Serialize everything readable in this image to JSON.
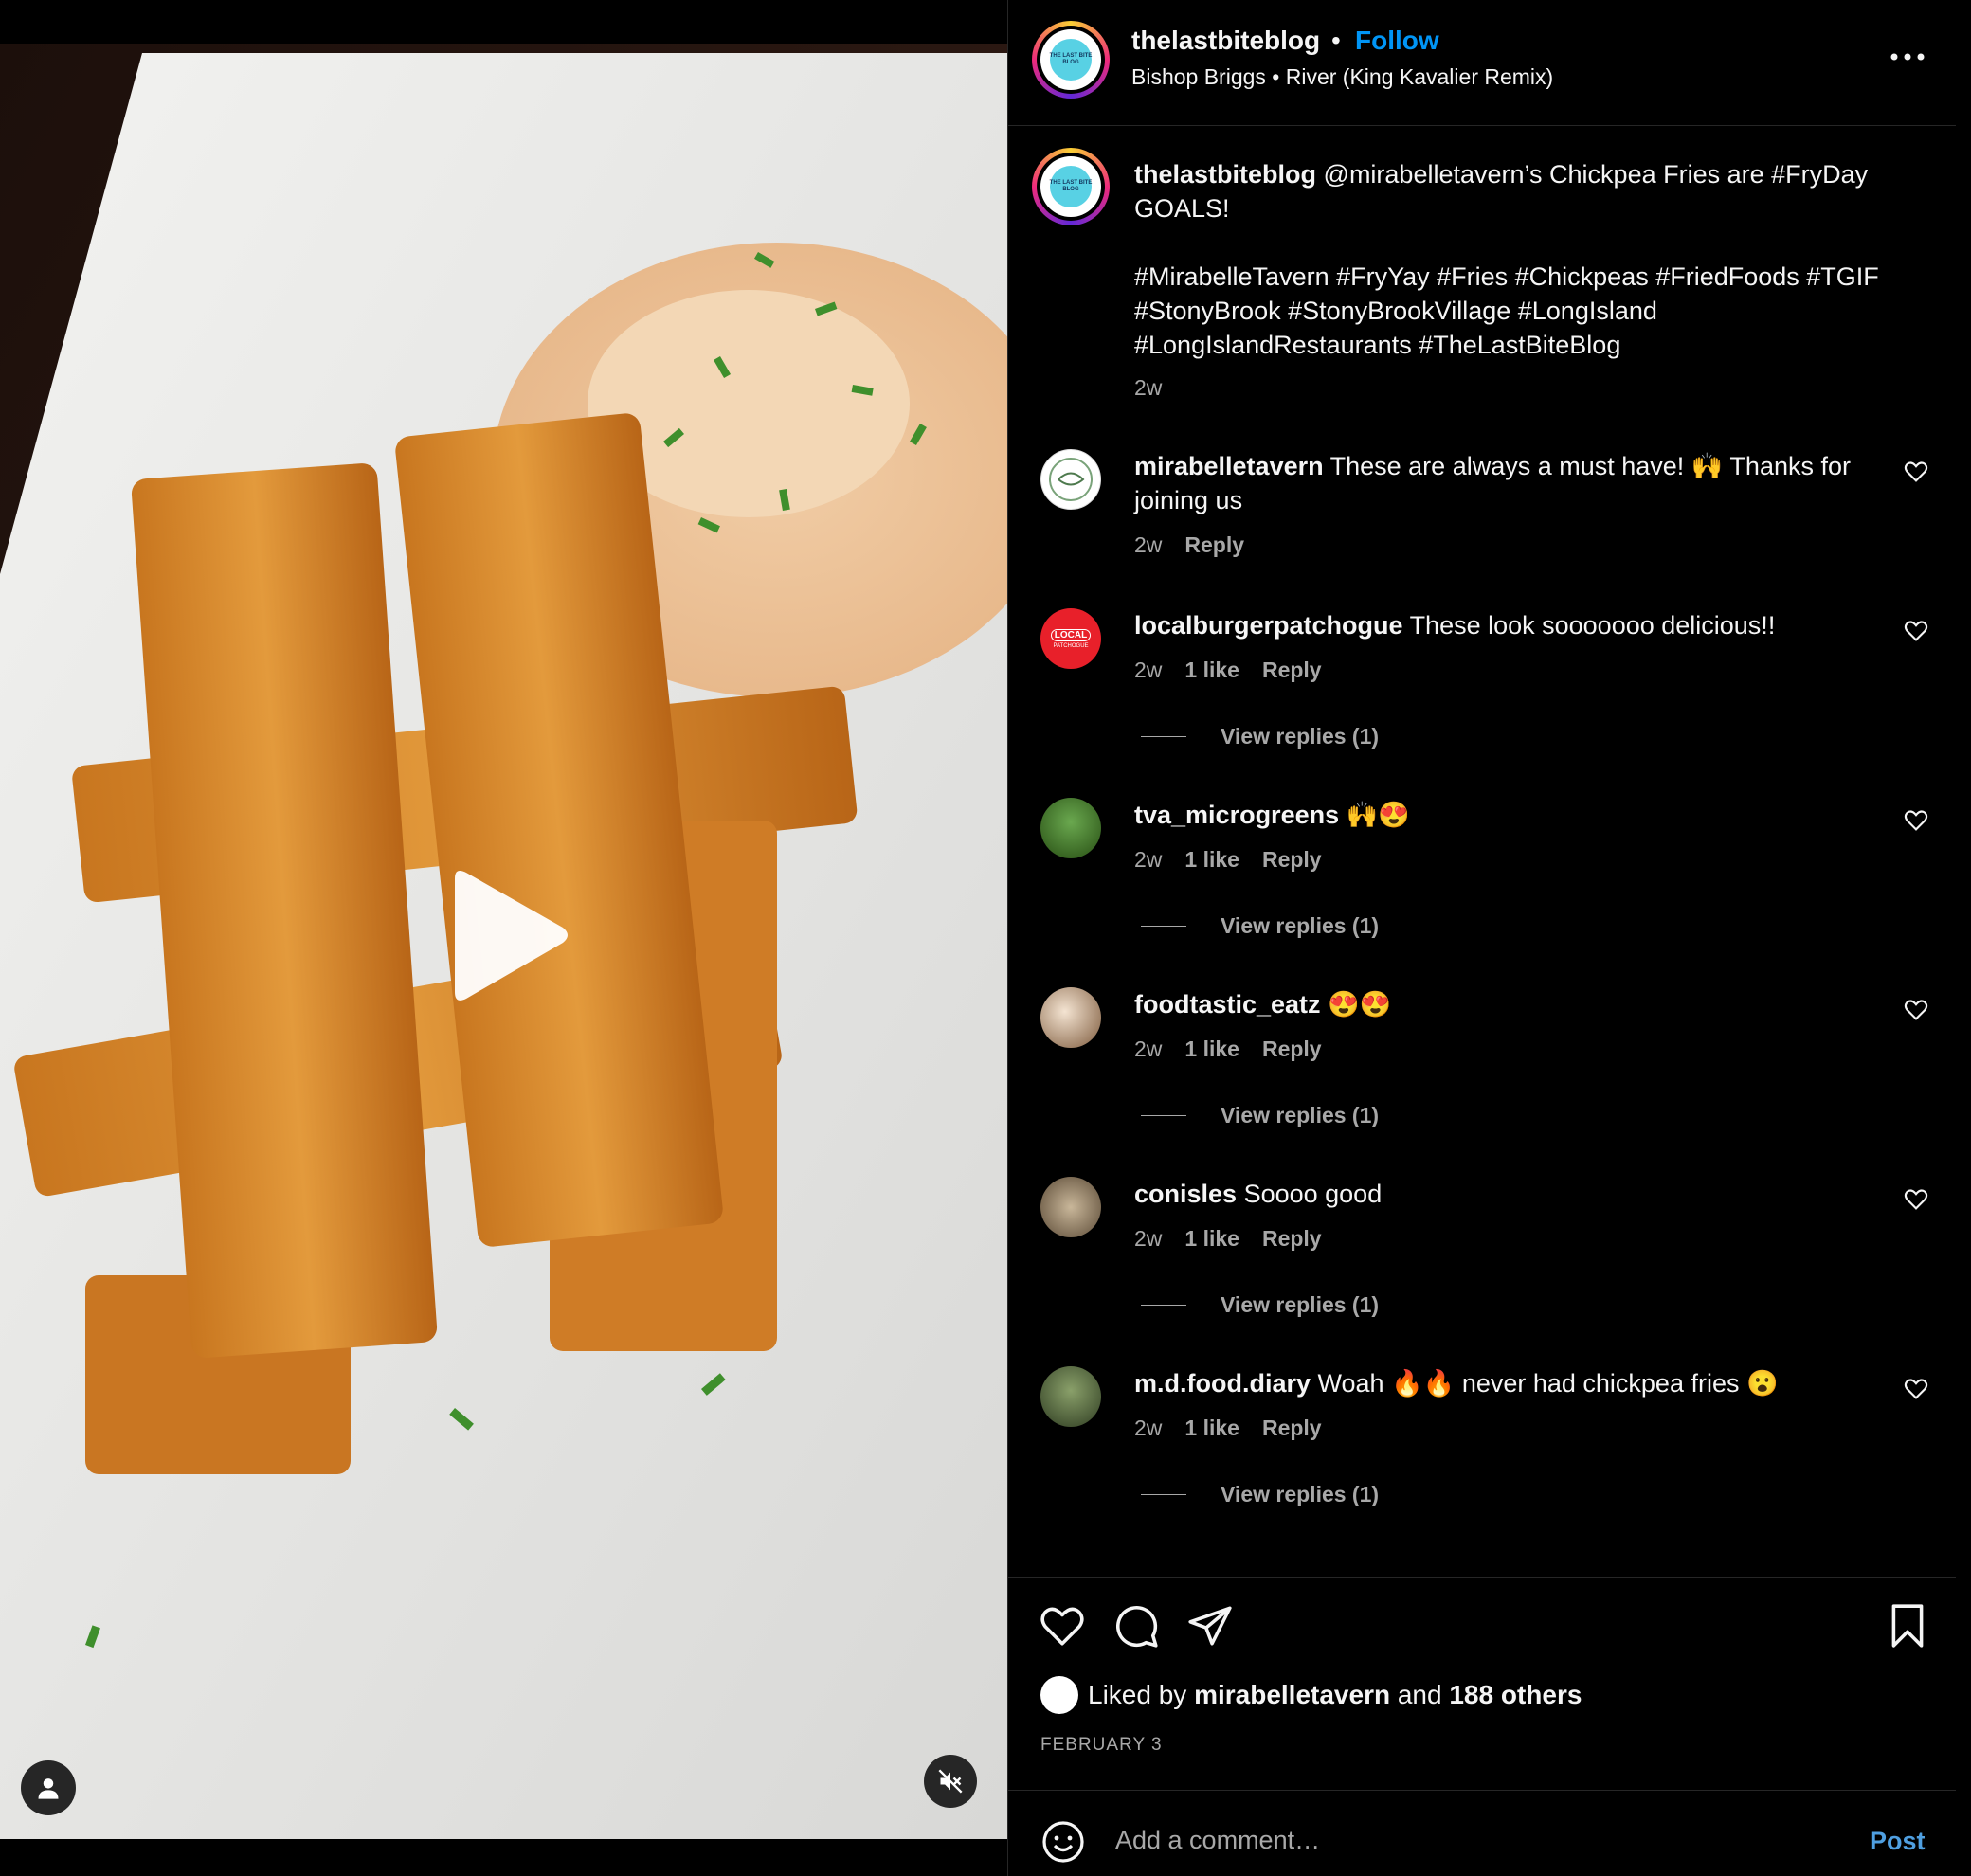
{
  "post": {
    "username": "thelastbiteblog",
    "separator": "•",
    "follow_label": "Follow",
    "audio": "Bishop Briggs • River (King Kavalier Remix)",
    "more_icon": "more-horizontal-icon"
  },
  "caption": {
    "username": "thelastbiteblog",
    "text": "@mirabelletavern’s Chickpea Fries are #FryDay GOALS!",
    "hashtags": "#MirabelleTavern #FryYay #Fries #Chickpeas #FriedFoods #TGIF #StonyBrook #StonyBrookVillage #LongIsland #LongIslandRestaurants #TheLastBiteBlog",
    "time": "2w"
  },
  "comments": [
    {
      "username": "mirabelletavern",
      "text": "These are always a must have! 🙌 Thanks for joining us",
      "time": "2w",
      "likes": "",
      "reply": "Reply",
      "view_replies": ""
    },
    {
      "username": "localburgerpatchogue",
      "text": "These look sooooooo delicious!!",
      "time": "2w",
      "likes": "1 like",
      "reply": "Reply",
      "view_replies": "View replies (1)"
    },
    {
      "username": "tva_microgreens",
      "text": "🙌😍",
      "time": "2w",
      "likes": "1 like",
      "reply": "Reply",
      "view_replies": "View replies (1)"
    },
    {
      "username": "foodtastic_eatz",
      "text": "😍😍",
      "time": "2w",
      "likes": "1 like",
      "reply": "Reply",
      "view_replies": "View replies (1)"
    },
    {
      "username": "conisles",
      "text": "Soooo good",
      "time": "2w",
      "likes": "1 like",
      "reply": "Reply",
      "view_replies": "View replies (1)"
    },
    {
      "username": "m.d.food.diary",
      "text": "Woah 🔥🔥 never had chickpea fries 😮",
      "time": "2w",
      "likes": "1 like",
      "reply": "Reply",
      "view_replies": "View replies (1)"
    }
  ],
  "likes": {
    "prefix": "Liked by",
    "user": "mirabelletavern",
    "and": "and",
    "others": "188 others"
  },
  "date": "FEBRUARY 3",
  "comment_box": {
    "placeholder": "Add a comment…",
    "post_label": "Post"
  },
  "logo_text": "THE LAST BITE BLOG",
  "local_logo_text": "LOCAL",
  "local_logo_sub": "PATCHOGUE",
  "colors": {
    "accent": "#0095f6",
    "background": "#000000",
    "secondary_text": "#a8a8a8"
  }
}
